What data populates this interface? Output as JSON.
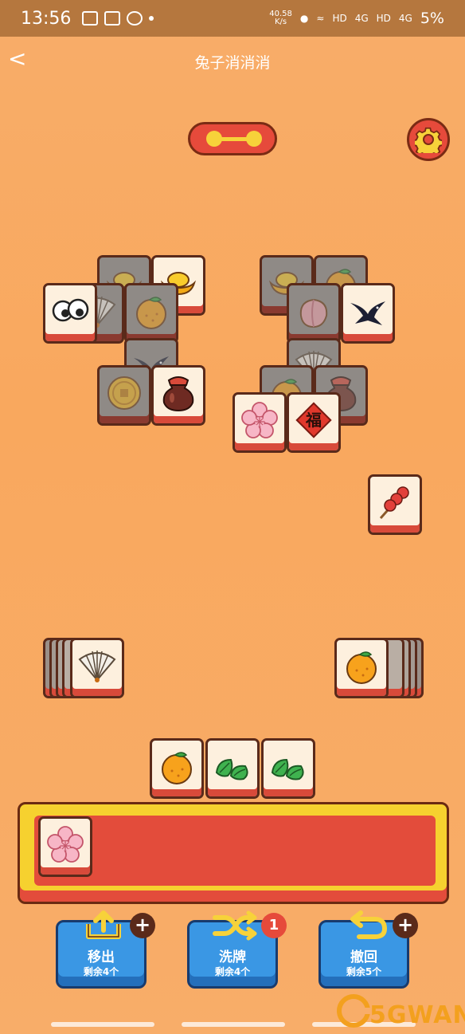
{
  "status_bar": {
    "time": "13:56",
    "speed_value": "40.58",
    "speed_unit": "K/s",
    "hd_1": "HD",
    "net_1": "4G",
    "hd_2": "HD",
    "net_2": "4G",
    "battery": "5%"
  },
  "header": {
    "back_symbol": "<",
    "title": "兔子消消消"
  },
  "colors": {
    "background": "#f9a85e",
    "status_bar": "#b5773e",
    "tile_face": "#fdf0de",
    "tile_rim": "#d84a3a",
    "tray_gold": "#f6d12f",
    "tray_red": "#e34c3b",
    "tool_blue": "#3a97e4"
  },
  "progress_indicator": {
    "icon": "progress-nodes-icon"
  },
  "settings": {
    "icon": "gear-icon"
  },
  "board": {
    "left_cluster": [
      "gold-ingot",
      "gold-ingot",
      "orange",
      "folding-fan",
      "googly-eyes",
      "swallow-bird",
      "gold-coin",
      "wine-jar"
    ],
    "right_cluster": [
      "gold-ingot",
      "orange",
      "peach",
      "swallow-bird",
      "folding-fan",
      "orange",
      "wine-jar",
      "plum-blossom",
      "fu-character"
    ],
    "single_tile": "candied-haws",
    "left_stack": {
      "top": "folding-fan"
    },
    "right_stack": {
      "top": "orange"
    },
    "center_row": [
      "orange",
      "leaf",
      "leaf"
    ]
  },
  "tray": {
    "slots": [
      "plum-blossom"
    ]
  },
  "fu_character": "福",
  "tools": [
    {
      "label": "移出",
      "remaining": "剩余4个",
      "icon": "move-out-icon",
      "corner": "+"
    },
    {
      "label": "洗牌",
      "remaining": "剩余4个",
      "icon": "shuffle-icon",
      "corner": "1"
    },
    {
      "label": "撤回",
      "remaining": "剩余5个",
      "icon": "undo-icon",
      "corner": "+"
    }
  ],
  "watermark": {
    "text": "5GWAN"
  }
}
